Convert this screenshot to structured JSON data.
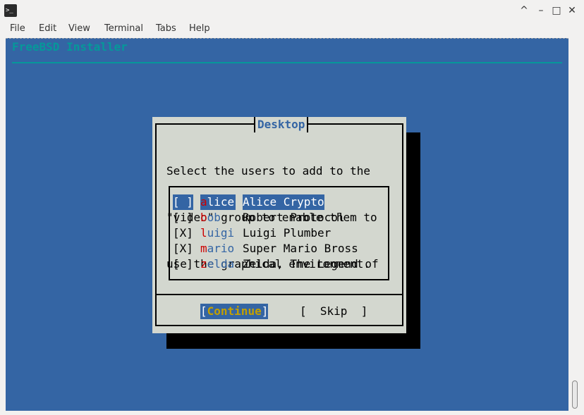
{
  "window": {
    "app_icon": "terminal-icon",
    "controls": {
      "up": "^",
      "minimize": "–",
      "maximize": "□",
      "close": "✕"
    }
  },
  "menu": [
    "File",
    "Edit",
    "View",
    "Terminal",
    "Tabs",
    "Help"
  ],
  "terminal": {
    "installer_title": "FreeBSD Installer",
    "dialog": {
      "title": "Desktop",
      "message_lines": [
        "Select the users to add to the",
        "\"video\" group to enable them to",
        "use the graphical environment."
      ],
      "users": [
        {
          "check": "[ ]",
          "hot": "a",
          "rest": "lice",
          "desc": "Alice Crypto",
          "selected": true
        },
        {
          "check": "[ ]",
          "hot": "b",
          "rest": "ob",
          "desc": "Robert Protocol",
          "selected": false
        },
        {
          "check": "[X]",
          "hot": "l",
          "rest": "uigi",
          "desc": "Luigi Plumber",
          "selected": false
        },
        {
          "check": "[X]",
          "hot": "m",
          "rest": "ario",
          "desc": "Super Mario Bross",
          "selected": false
        },
        {
          "check": "[ ]",
          "hot": "z",
          "rest": "elda",
          "desc": "Zelda, The Legend of",
          "selected": false
        }
      ],
      "buttons": {
        "continue_open": "[",
        "continue_label": "Continue",
        "continue_close": "]",
        "skip": "[  Skip  ]"
      }
    }
  },
  "colors": {
    "terminal_bg": "#3465a4",
    "dialog_bg": "#d3d7cf",
    "title_cyan": "#06989a",
    "hotkey_red": "#cc0000",
    "button_hotkey_yellow": "#c4a000"
  }
}
